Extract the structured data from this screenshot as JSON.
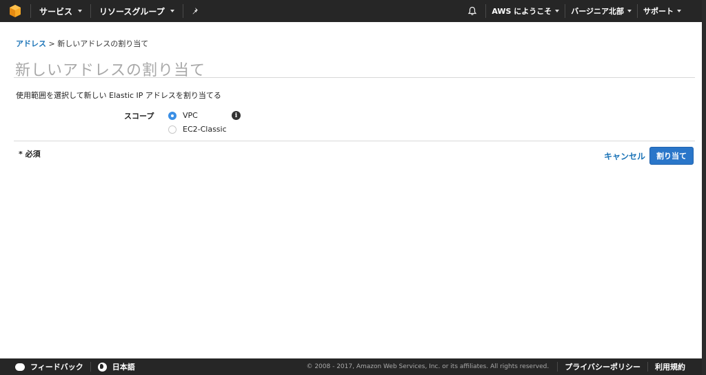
{
  "topnav": {
    "logo_icon": "aws-cube-icon",
    "services": "サービス",
    "resource_groups": "リソースグループ",
    "pin_icon": "pin-icon",
    "bell_icon": "bell-icon",
    "account": "AWS にようこそ",
    "region": "バージニア北部",
    "support": "サポート"
  },
  "breadcrumb": {
    "parent": "アドレス",
    "separator": " > ",
    "current": "新しいアドレスの割り当て"
  },
  "page": {
    "title": "新しいアドレスの割り当て",
    "description": "使用範囲を選択して新しい Elastic IP アドレスを割り当てる"
  },
  "form": {
    "scope_label": "スコープ",
    "options": [
      {
        "label": "VPC",
        "selected": true
      },
      {
        "label": "EC2-Classic",
        "selected": false
      }
    ],
    "info_icon": "info-icon",
    "required_note": "* 必須",
    "cancel_label": "キャンセル",
    "assign_label": "割り当て"
  },
  "footer": {
    "feedback": "フィードバック",
    "language": "日本語",
    "copyright": "© 2008 - 2017, Amazon Web Services, Inc. or its affiliates. All rights reserved.",
    "privacy": "プライバシーポリシー",
    "terms": "利用規約"
  },
  "colors": {
    "nav_bg": "#262626",
    "accent_orange": "#f7a823",
    "link_blue": "#1a73b7",
    "primary_button": "#2a76c9"
  }
}
